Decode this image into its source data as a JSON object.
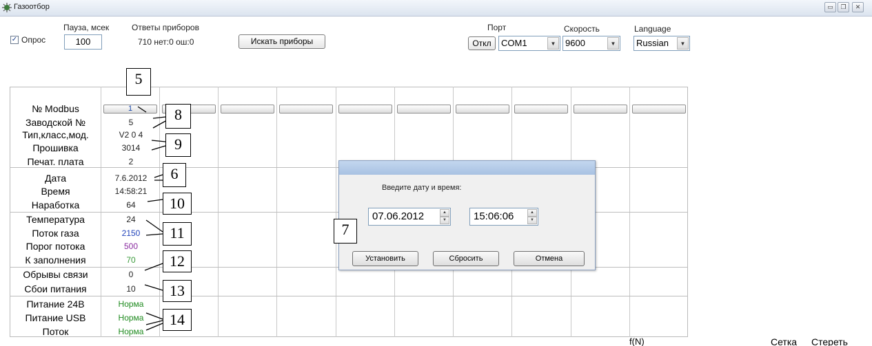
{
  "window": {
    "title": "Газоотбор",
    "controls": [
      "minimize",
      "restore",
      "close"
    ]
  },
  "top": {
    "poll_label": "Опрос",
    "poll_checked": true,
    "pause_label": "Пауза, мсек",
    "pause_value": "100",
    "answers_label": "Ответы приборов",
    "answers_value": "710 нет:0 ош:0",
    "search_button": "Искать приборы",
    "port_label": "Порт",
    "disconnect_button": "Откл",
    "port_value": "COM1",
    "speed_label": "Скорость",
    "speed_value": "9600",
    "language_label": "Language",
    "language_value": "Russian"
  },
  "grid": {
    "rows": [
      {
        "label": "№ Modbus",
        "value": "1",
        "color": "#1a47a8"
      },
      {
        "label": "Заводской №",
        "value": "5",
        "color": "#222222"
      },
      {
        "label": "Тип,класс,мод.",
        "value": "V2  0  4",
        "color": "#222222"
      },
      {
        "label": "Прошивка",
        "value": "3014",
        "color": "#222222"
      },
      {
        "label": "Печат. плата",
        "value": "2",
        "color": "#222222"
      },
      {
        "label": "Дата",
        "value": "7.6.2012",
        "color": "#222222"
      },
      {
        "label": "Время",
        "value": "14:58:21",
        "color": "#222222"
      },
      {
        "label": "Наработка",
        "value": "64",
        "color": "#222222"
      },
      {
        "label": "Температура",
        "value": "24",
        "color": "#222222"
      },
      {
        "label": "Поток газа",
        "value": "2150",
        "color": "#2244bb"
      },
      {
        "label": "Порог потока",
        "value": "500",
        "color": "#8a2ba0"
      },
      {
        "label": "К заполнения",
        "value": "70",
        "color": "#3a9a3a"
      },
      {
        "label": "Обрывы связи",
        "value": "0",
        "color": "#222222"
      },
      {
        "label": "Сбои питания",
        "value": "10",
        "color": "#222222"
      },
      {
        "label": "Питание 24В",
        "value": "Норма",
        "color": "#1f8a1f"
      },
      {
        "label": "Питание USB",
        "value": "Норма",
        "color": "#1f8a1f"
      },
      {
        "label": "Поток",
        "value": "Норма",
        "color": "#1f8a1f"
      }
    ]
  },
  "callouts": [
    "5",
    "8",
    "9",
    "6",
    "10",
    "11",
    "12",
    "13",
    "14",
    "7"
  ],
  "dialog": {
    "prompt": "Введите дату и время:",
    "date_value": "07.06.2012",
    "time_value": "15:06:06",
    "set_button": "Установить",
    "reset_button": "Сбросить",
    "cancel_button": "Отмена"
  },
  "bottom": {
    "fn_label": "f(N)",
    "grid_label": "Сетка",
    "erase_label": "Стереть"
  }
}
